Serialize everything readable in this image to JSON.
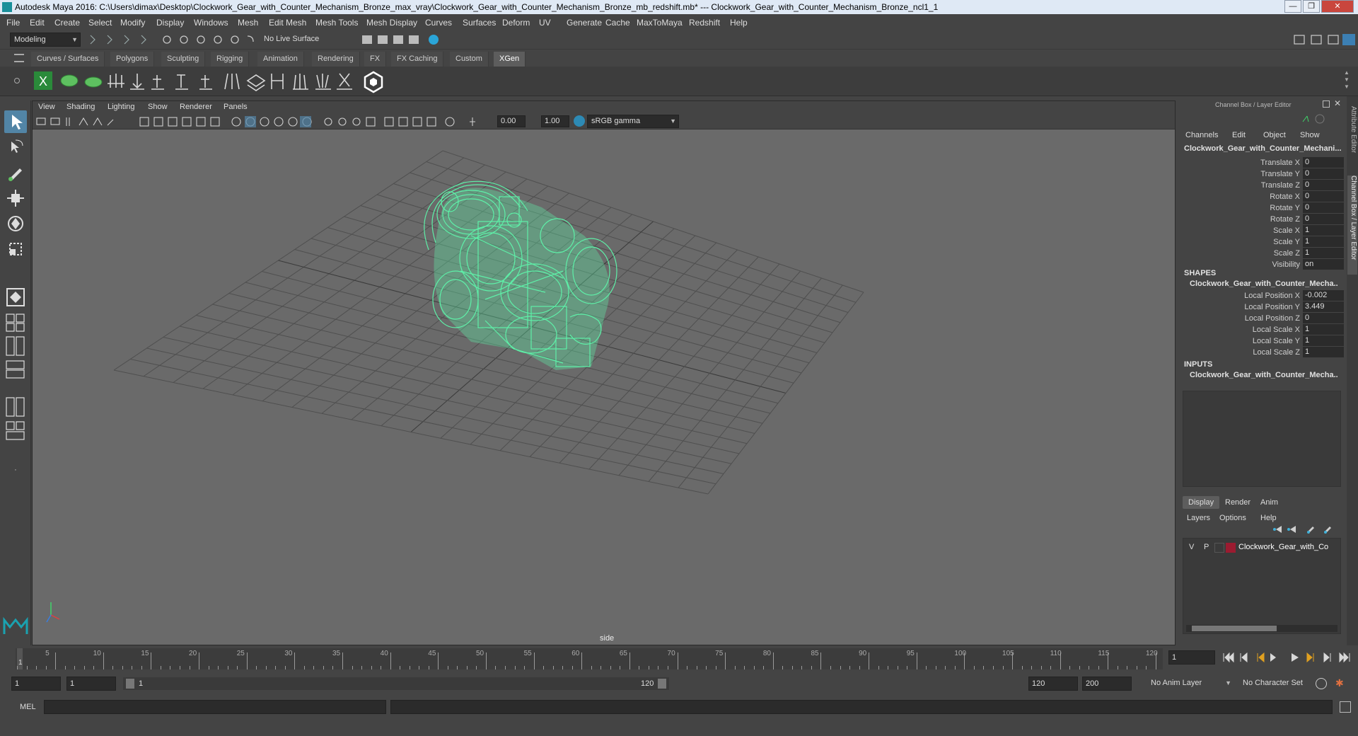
{
  "window": {
    "title": "Autodesk Maya 2016: C:\\Users\\dimax\\Desktop\\Clockwork_Gear_with_Counter_Mechanism_Bronze_max_vray\\Clockwork_Gear_with_Counter_Mechanism_Bronze_mb_redshift.mb*   ---   Clockwork_Gear_with_Counter_Mechanism_Bronze_ncl1_1",
    "min": "—",
    "max": "❐",
    "close": "✕"
  },
  "menu": [
    "File",
    "Edit",
    "Create",
    "Select",
    "Modify",
    "Display",
    "Windows",
    "Mesh",
    "Edit Mesh",
    "Mesh Tools",
    "Mesh Display",
    "Curves",
    "Surfaces",
    "Deform",
    "UV",
    "Generate",
    "Cache",
    "MaxToMaya",
    "Redshift",
    "Help"
  ],
  "status": {
    "mode": "Modeling",
    "live_surface": "No Live Surface"
  },
  "shelf_tabs": [
    {
      "label": "Curves / Surfaces",
      "active": false
    },
    {
      "label": "Polygons",
      "active": false
    },
    {
      "label": "Sculpting",
      "active": false
    },
    {
      "label": "Rigging",
      "active": false
    },
    {
      "label": "Animation",
      "active": false
    },
    {
      "label": "Rendering",
      "active": false
    },
    {
      "label": "FX",
      "active": false
    },
    {
      "label": "FX Caching",
      "active": false
    },
    {
      "label": "Custom",
      "active": false
    },
    {
      "label": "XGen",
      "active": true
    }
  ],
  "viewport": {
    "menu": [
      "View",
      "Shading",
      "Lighting",
      "Show",
      "Renderer",
      "Panels"
    ],
    "field_a": "0.00",
    "field_b": "1.00",
    "colorspace": "sRGB gamma",
    "camera_label": "side",
    "wire_color": "#5ef0a8"
  },
  "channelbox": {
    "title": "Channel Box / Layer Editor",
    "menus": [
      "Channels",
      "Edit",
      "Object",
      "Show"
    ],
    "object": "Clockwork_Gear_with_Counter_Mechani...",
    "attrs": [
      {
        "label": "Translate X",
        "value": "0"
      },
      {
        "label": "Translate Y",
        "value": "0"
      },
      {
        "label": "Translate Z",
        "value": "0"
      },
      {
        "label": "Rotate X",
        "value": "0"
      },
      {
        "label": "Rotate Y",
        "value": "0"
      },
      {
        "label": "Rotate Z",
        "value": "0"
      },
      {
        "label": "Scale X",
        "value": "1"
      },
      {
        "label": "Scale Y",
        "value": "1"
      },
      {
        "label": "Scale Z",
        "value": "1"
      },
      {
        "label": "Visibility",
        "value": "on"
      }
    ],
    "shapes_header": "SHAPES",
    "shape_name": "Clockwork_Gear_with_Counter_Mecha...",
    "shape_attrs": [
      {
        "label": "Local Position X",
        "value": "-0.002"
      },
      {
        "label": "Local Position Y",
        "value": "3.449"
      },
      {
        "label": "Local Position Z",
        "value": "0"
      },
      {
        "label": "Local Scale X",
        "value": "1"
      },
      {
        "label": "Local Scale Y",
        "value": "1"
      },
      {
        "label": "Local Scale Z",
        "value": "1"
      }
    ],
    "inputs_header": "INPUTS",
    "input_name": "Clockwork_Gear_with_Counter_Mecha..."
  },
  "layers": {
    "tabs": [
      {
        "label": "Display",
        "active": true
      },
      {
        "label": "Render",
        "active": false
      },
      {
        "label": "Anim",
        "active": false
      }
    ],
    "menus": [
      "Layers",
      "Options",
      "Help"
    ],
    "row": {
      "v": "V",
      "p": "P",
      "name": "Clockwork_Gear_with_Co",
      "color": "#9b1b30"
    }
  },
  "side_tabs": {
    "attr_editor": "Attribute Editor",
    "channel_box": "Channel Box / Layer Editor"
  },
  "timeline": {
    "ticks": [
      5,
      10,
      15,
      20,
      25,
      30,
      35,
      40,
      45,
      50,
      55,
      60,
      65,
      70,
      75,
      80,
      85,
      90,
      95,
      100,
      105,
      110,
      115,
      120
    ],
    "start_label": "1",
    "current_frame": "1"
  },
  "range": {
    "start": "1",
    "start2": "1",
    "inner_start": "1",
    "inner_end": "120",
    "end": "120",
    "end2": "200",
    "anim_layer": "No Anim Layer",
    "char_set": "No Character Set"
  },
  "cmd": {
    "label": "MEL"
  }
}
